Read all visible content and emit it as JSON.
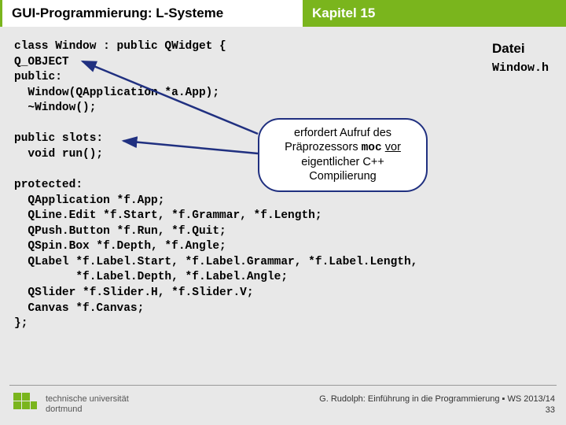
{
  "header": {
    "left": "GUI-Programmierung: L-Systeme",
    "right": "Kapitel 15"
  },
  "datei": {
    "label": "Datei",
    "filename": "Window.h"
  },
  "code": {
    "l1": "class Window : public QWidget {",
    "l2": "Q_OBJECT",
    "l3": "public:",
    "l4": "  Window(QApplication *a.App);",
    "l5": "  ~Window();",
    "l6": "",
    "l7": "public slots:",
    "l8": "  void run();",
    "l9": "",
    "l10": "protected:",
    "l11": "  QApplication *f.App;",
    "l12": "  QLine.Edit *f.Start, *f.Grammar, *f.Length;",
    "l13": "  QPush.Button *f.Run, *f.Quit;",
    "l14": "  QSpin.Box *f.Depth, *f.Angle;",
    "l15": "  QLabel *f.Label.Start, *f.Label.Grammar, *f.Label.Length,",
    "l16": "         *f.Label.Depth, *f.Label.Angle;",
    "l17": "  QSlider *f.Slider.H, *f.Slider.V;",
    "l18": "  Canvas *f.Canvas;",
    "l19": "};"
  },
  "callout": {
    "t1": "erfordert Aufruf des",
    "t2a": "Präprozessors ",
    "moc": "moc",
    "t2b": " ",
    "vor": "vor",
    "t3": "eigentlicher C++",
    "t4": "Compilierung"
  },
  "footer": {
    "uni1": "technische universität",
    "uni2": "dortmund",
    "credit": "G. Rudolph: Einführung in die Programmierung ▪ WS 2013/14",
    "page": "33"
  }
}
